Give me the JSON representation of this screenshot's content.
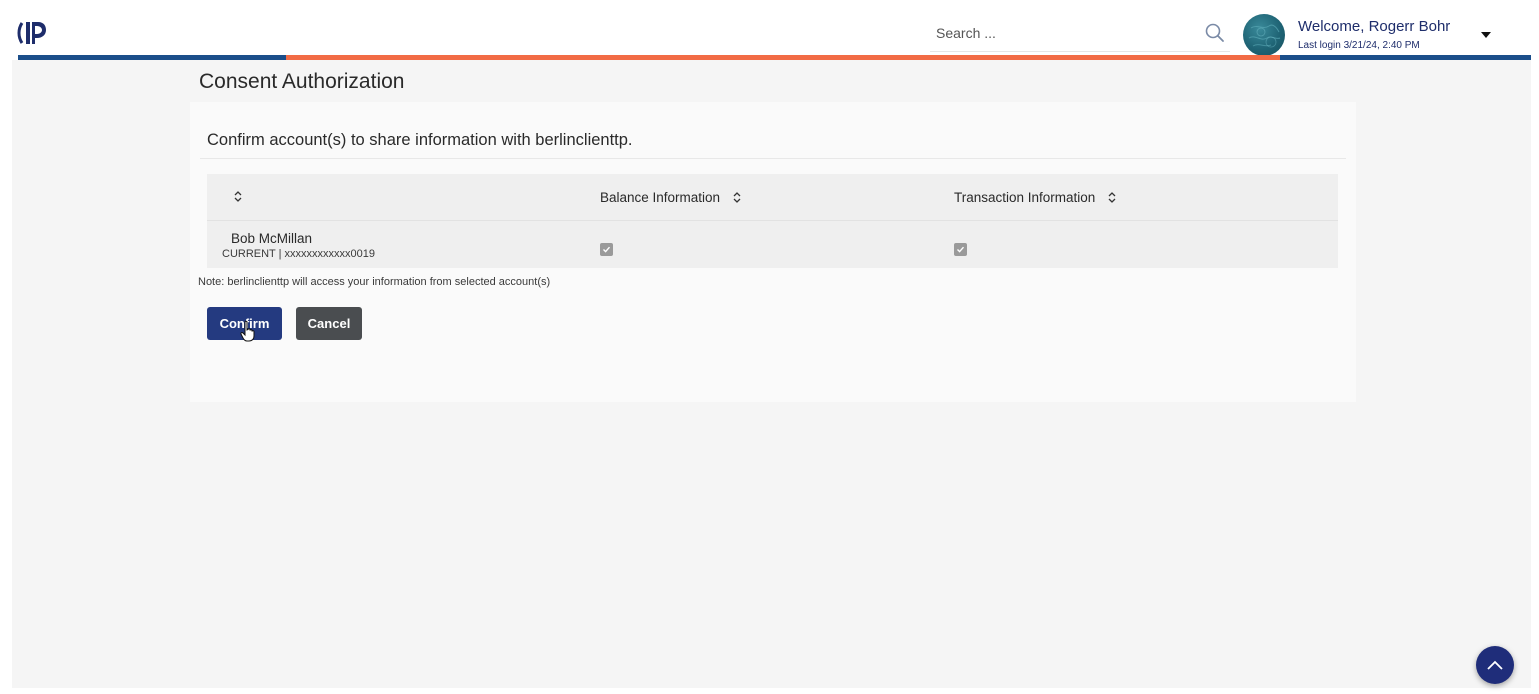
{
  "header": {
    "search_placeholder": "Search ...",
    "welcome": "Welcome, Rogerr Bohr",
    "last_login": "Last login 3/21/24, 2:40 PM"
  },
  "page": {
    "title": "Consent Authorization",
    "heading": "Confirm account(s) to share information with berlinclienttp.",
    "note": "Note: berlinclienttp will access your information from selected account(s)"
  },
  "table": {
    "columns": [
      "",
      "Balance Information",
      "Transaction Information"
    ],
    "rows": [
      {
        "name": "Bob McMillan",
        "detail": "CURRENT | xxxxxxxxxxxx0019",
        "balance_checked": true,
        "transaction_checked": true
      }
    ]
  },
  "buttons": {
    "confirm": "Confirm",
    "cancel": "Cancel"
  },
  "colors": {
    "brand_blue": "#1b4e8a",
    "accent_orange": "#f26b45",
    "confirm_button": "#243a80",
    "cancel_button": "#4a4d50"
  },
  "icons": {
    "logo": "brand-logo-icon",
    "search": "search-icon",
    "caret": "chevron-down-icon",
    "sort": "sort-icon",
    "scroll_top": "chevron-up-icon"
  }
}
